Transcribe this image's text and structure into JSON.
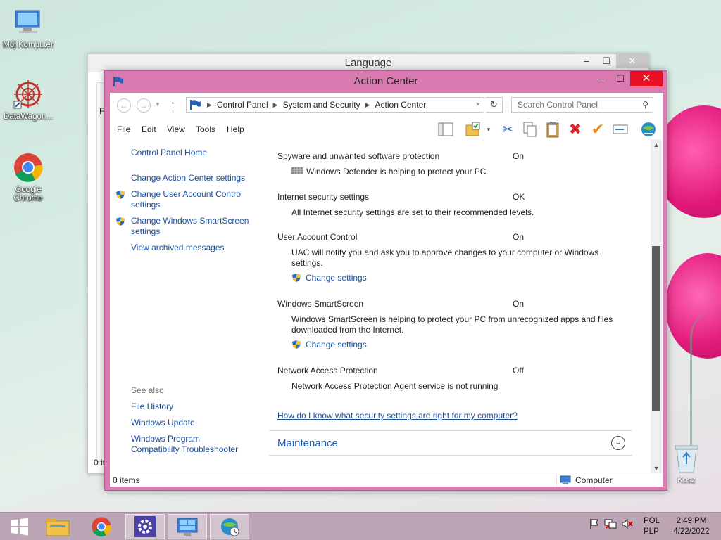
{
  "desktop": {
    "icons": [
      {
        "label": "Mój Komputer"
      },
      {
        "label": "DataWagon..."
      },
      {
        "label": "Google Chrome"
      }
    ],
    "recycle_bin": "Kosz"
  },
  "background_window": {
    "title": "Language",
    "fragment_top": "Fi",
    "fragment_bottom": "0 it"
  },
  "window": {
    "title": "Action Center",
    "controls": {
      "minimize": "–",
      "maximize": "☐",
      "close": "✕"
    }
  },
  "address": {
    "breadcrumb": [
      "Control Panel",
      "System and Security",
      "Action Center"
    ],
    "search_placeholder": "Search Control Panel"
  },
  "menu": [
    "File",
    "Edit",
    "View",
    "Tools",
    "Help"
  ],
  "left_pane": {
    "home": "Control Panel Home",
    "links": [
      "Change Action Center settings",
      "Change User Account Control settings",
      "Change Windows SmartScreen settings",
      "View archived messages"
    ],
    "see_also_title": "See also",
    "see_also": [
      "File History",
      "Windows Update",
      "Windows Program Compatibility Troubleshooter"
    ]
  },
  "security": [
    {
      "name": "Spyware and unwanted software protection",
      "status": "On",
      "desc": "Windows Defender is helping to protect your PC."
    },
    {
      "name": "Internet security settings",
      "status": "OK",
      "desc": "All Internet security settings are set to their recommended levels."
    },
    {
      "name": "User Account Control",
      "status": "On",
      "desc": "UAC will notify you and ask you to approve changes to your computer or Windows settings.",
      "link": "Change settings"
    },
    {
      "name": "Windows SmartScreen",
      "status": "On",
      "desc": "Windows SmartScreen is helping to protect your PC from unrecognized apps and files downloaded from the Internet.",
      "link": "Change settings"
    },
    {
      "name": "Network Access Protection",
      "status": "Off",
      "desc": "Network Access Protection Agent service is not running"
    }
  ],
  "help_link": "How do I know what security settings are right for my computer?",
  "maintenance": "Maintenance",
  "status_bar": {
    "items": "0 items",
    "zone": "Computer"
  },
  "taskbar": {
    "lang_top": "POL",
    "lang_bottom": "PLP",
    "time": "2:49 PM",
    "date": "4/22/2022"
  },
  "colors": {
    "window_frame": "#d97bb0",
    "close": "#e81123",
    "link": "#1a4f9c"
  }
}
